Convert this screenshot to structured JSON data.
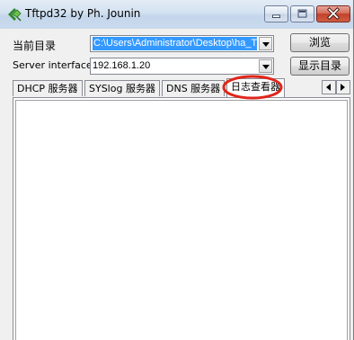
{
  "window": {
    "title": "Tftpd32 by Ph. Jounin",
    "controls": {
      "minimize": "minimize",
      "maximize": "maximize",
      "close": "close"
    }
  },
  "form": {
    "current_dir_label": "当前目录",
    "current_dir_value": "C:\\Users\\Administrator\\Desktop\\ha_T",
    "browse_button": "浏览",
    "server_interface_label": "Server interface",
    "server_interface_value": "192.168.1.20",
    "show_dir_button": "显示目录"
  },
  "tabs": [
    {
      "label": "DHCP 服务器",
      "active": false
    },
    {
      "label": "SYSlog 服务器",
      "active": false
    },
    {
      "label": "DNS 服务器",
      "active": false
    },
    {
      "label": "日志查看器",
      "active": true
    }
  ],
  "colors": {
    "selection": "#3399ff",
    "annotation": "#e0261b",
    "titlebar": "#d3e1f0"
  },
  "icons": {
    "app": "tftp-app-icon",
    "minimize": "minimize-icon",
    "maximize": "maximize-icon",
    "close": "close-icon",
    "dropdown": "chevron-down-icon",
    "scroll_left": "arrow-left-icon",
    "scroll_right": "arrow-right-icon"
  },
  "log_viewer": {
    "entries": []
  }
}
